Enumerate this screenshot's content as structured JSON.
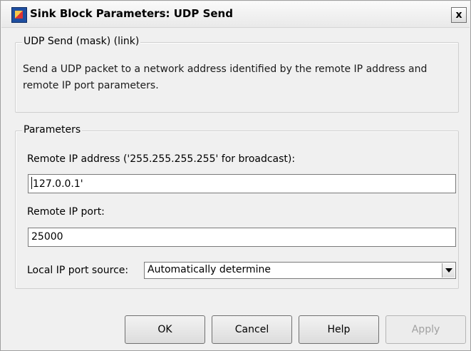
{
  "window": {
    "title": "Sink Block Parameters: UDP Send",
    "close_symbol": "x"
  },
  "description_group": {
    "legend": "UDP Send (mask) (link)",
    "text": "Send a UDP packet to a network address identified by the remote IP address and remote IP port parameters."
  },
  "parameters_group": {
    "legend": "Parameters",
    "remote_ip_label": "Remote IP address ('255.255.255.255' for broadcast):",
    "remote_ip_value": "127.0.0.1'",
    "remote_port_label": "Remote IP port:",
    "remote_port_value": "25000",
    "local_port_source_label": "Local IP port source:",
    "local_port_source_value": "Automatically determine"
  },
  "buttons": {
    "ok": "OK",
    "cancel": "Cancel",
    "help": "Help",
    "apply": "Apply"
  },
  "icons": {
    "window_icon": "simulink-block-icon",
    "close": "close-icon",
    "dropdown": "chevron-down-icon"
  }
}
